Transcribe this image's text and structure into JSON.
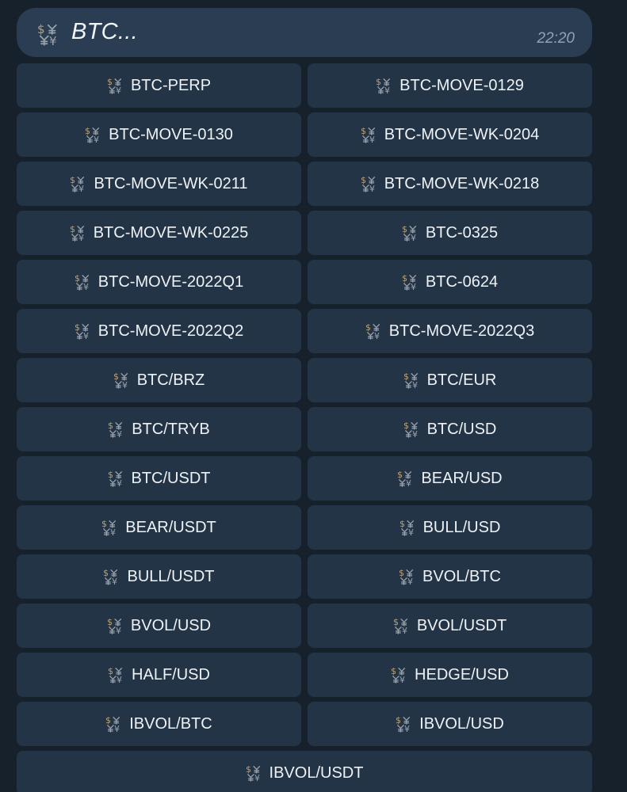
{
  "message": {
    "text": "BTC...",
    "time": "22:20",
    "icon": "currency-exchange-icon"
  },
  "keyboard": {
    "button_icon": "currency-exchange-icon",
    "rows": [
      [
        "BTC-PERP",
        "BTC-MOVE-0129"
      ],
      [
        "BTC-MOVE-0130",
        "BTC-MOVE-WK-0204"
      ],
      [
        "BTC-MOVE-WK-0211",
        "BTC-MOVE-WK-0218"
      ],
      [
        "BTC-MOVE-WK-0225",
        "BTC-0325"
      ],
      [
        "BTC-MOVE-2022Q1",
        "BTC-0624"
      ],
      [
        "BTC-MOVE-2022Q2",
        "BTC-MOVE-2022Q3"
      ],
      [
        "BTC/BRZ",
        "BTC/EUR"
      ],
      [
        "BTC/TRYB",
        "BTC/USD"
      ],
      [
        "BTC/USDT",
        "BEAR/USD"
      ],
      [
        "BEAR/USDT",
        "BULL/USD"
      ],
      [
        "BULL/USDT",
        "BVOL/BTC"
      ],
      [
        "BVOL/USD",
        "BVOL/USDT"
      ],
      [
        "HALF/USD",
        "HEDGE/USD"
      ],
      [
        "IBVOL/BTC",
        "IBVOL/USD"
      ],
      [
        "IBVOL/USDT"
      ]
    ]
  },
  "colors": {
    "background": "#17212b",
    "bubble": "#2b3d52",
    "button": "#243447",
    "text": "#eef2f6",
    "time": "#8ea3b8"
  }
}
